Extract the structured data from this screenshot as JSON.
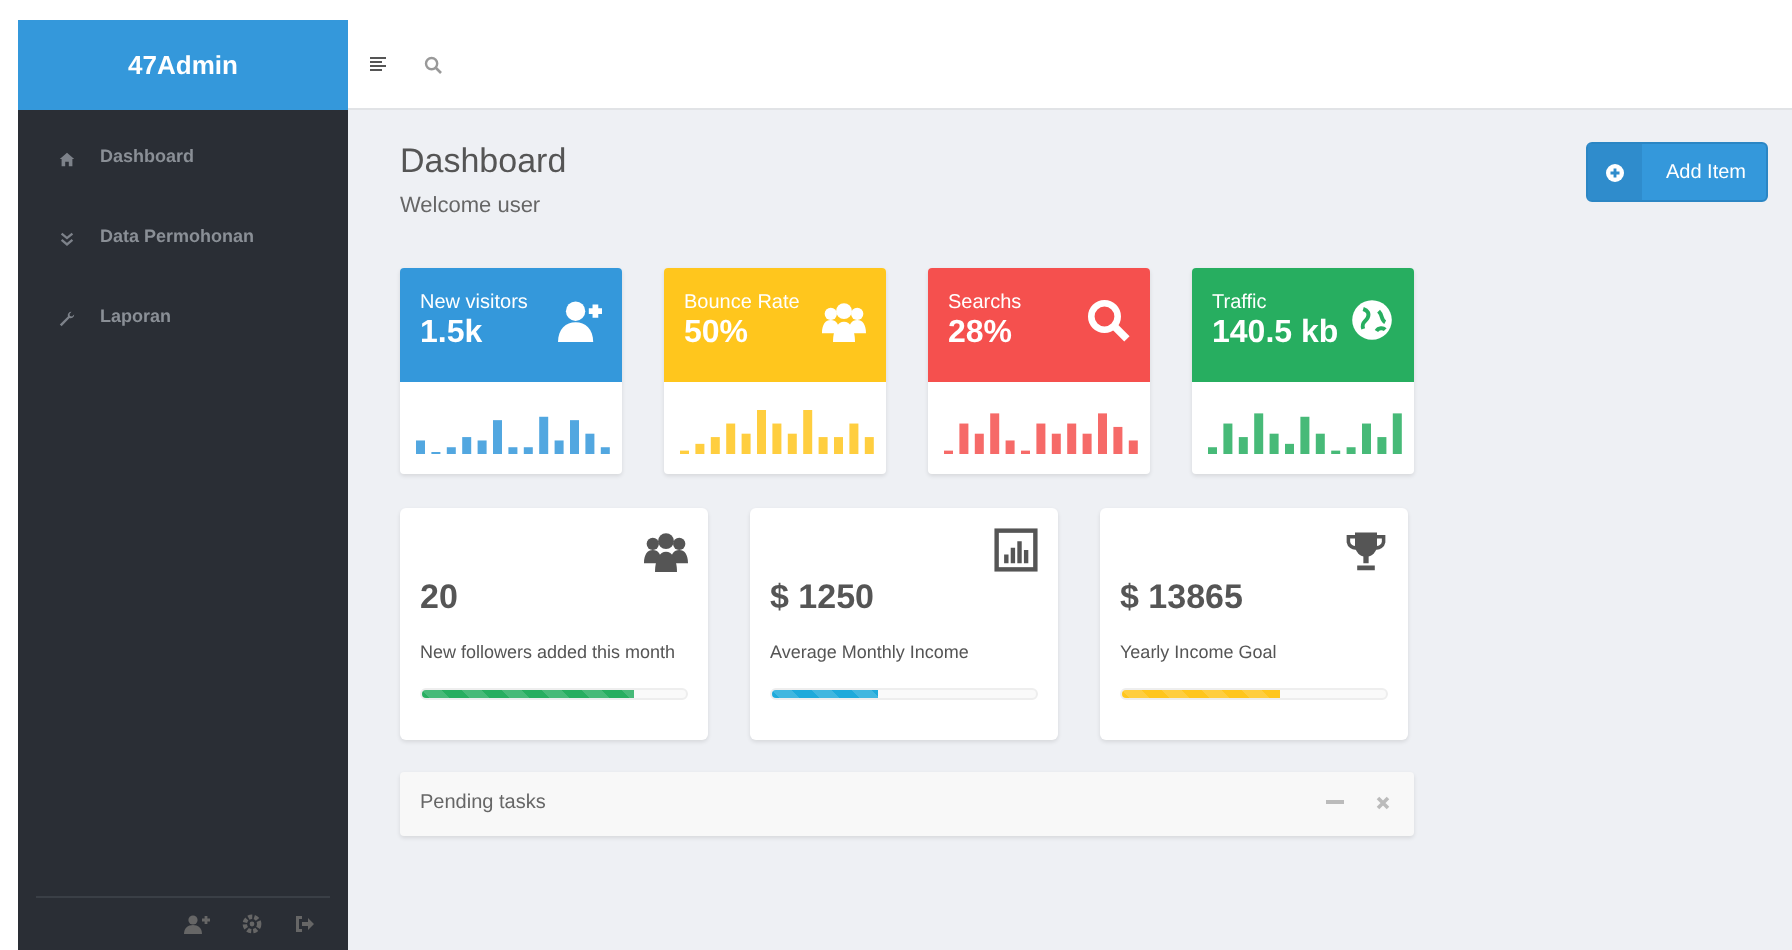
{
  "brand": "47Admin",
  "sidebar": {
    "items": [
      {
        "label": "Dashboard"
      },
      {
        "label": "Data Permohonan"
      },
      {
        "label": "Laporan"
      }
    ]
  },
  "header": {
    "title": "Dashboard",
    "subtitle": "Welcome user",
    "button": "Add Item"
  },
  "stat_cards": [
    {
      "label": "New visitors",
      "value": "1.5k",
      "color": "#3498db"
    },
    {
      "label": "Bounce Rate",
      "value": "50%",
      "color": "#ffc61d"
    },
    {
      "label": "Searchs",
      "value": "28%",
      "color": "#f5504e"
    },
    {
      "label": "Traffic",
      "value": "140.5 kb",
      "color": "#27ae60"
    }
  ],
  "summary_cards": [
    {
      "value": "20",
      "label": "New followers added this month",
      "level": 0.8,
      "color": "#27ae60"
    },
    {
      "value": "$ 1250",
      "label": "Average Monthly Income",
      "level": 0.4,
      "color": "#1eaadb"
    },
    {
      "value": "$ 13865",
      "label": "Yearly Income Goal",
      "level": 0.6,
      "color": "#ffc61d"
    }
  ],
  "panel": {
    "title": "Pending tasks"
  }
}
